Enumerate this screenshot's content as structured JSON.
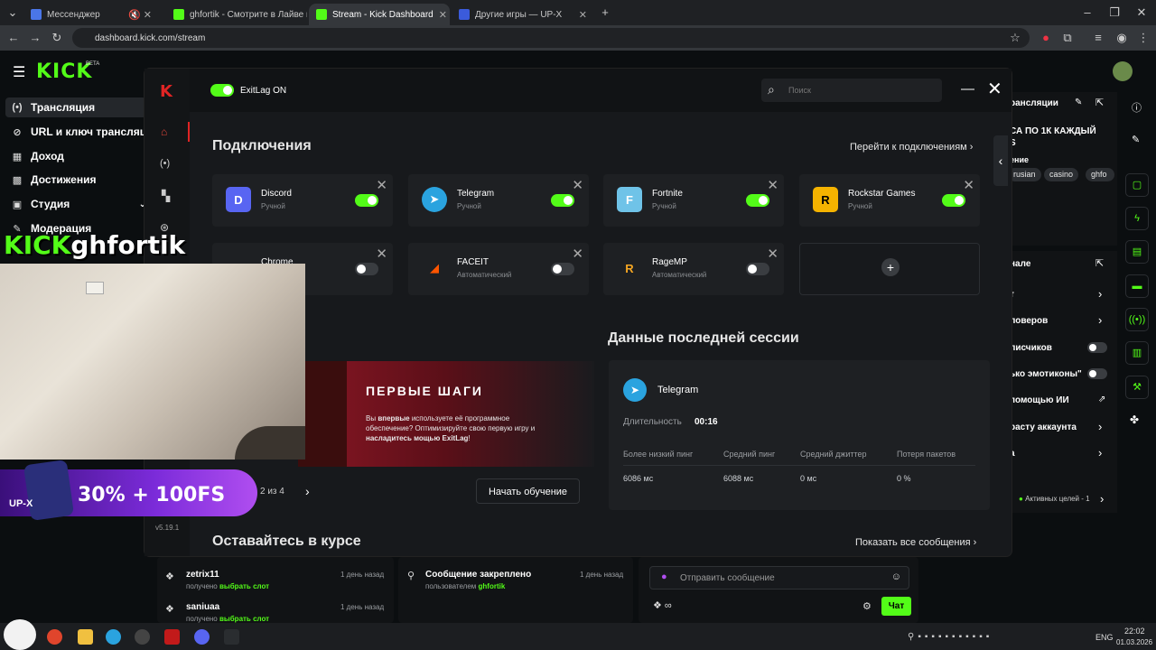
{
  "browser": {
    "tabs": [
      {
        "title": "Мессенджер",
        "color": "#4a76e8"
      },
      {
        "title": "ghfortik - Смотрите в Лайве н",
        "color": "#53fc18"
      },
      {
        "title": "Stream - Kick Dashboard",
        "color": "#53fc18"
      },
      {
        "title": "Другие игры — UP-X",
        "color": "#3b5bdb"
      }
    ],
    "url": "dashboard.kick.com/stream"
  },
  "kick": {
    "logo": "KICK",
    "beta": "BETA",
    "sidebar": [
      {
        "label": "Трансляция",
        "icon": "(•)"
      },
      {
        "label": "URL и ключ трансляции",
        "icon": "⊘"
      },
      {
        "label": "Доход",
        "icon": "▦"
      },
      {
        "label": "Достижения",
        "icon": "▩"
      },
      {
        "label": "Студия",
        "icon": "▣"
      },
      {
        "label": "Модерация",
        "icon": "✎"
      }
    ],
    "right_panel": {
      "title": "рансляции",
      "stream_title": "СА ПО 1К КАЖДЫЙ",
      "stream_title2": "S",
      "section": "ение",
      "tags": [
        "rusian",
        "casino",
        "ghfo"
      ],
      "chat_title": "нале",
      "rows": [
        "т",
        "ловеров",
        "лисчиков",
        "ько эмотиконы\"",
        "помощью ИИ",
        "расту аккаунта",
        "а"
      ],
      "goals": "Активных целей - 1"
    }
  },
  "exitlag": {
    "status": "ExitLag ON",
    "search_placeholder": "Поиск",
    "connections_title": "Подключения",
    "connections_link": "Перейти к подключениям",
    "apps": [
      {
        "name": "Discord",
        "mode": "Ручной",
        "on": true,
        "icon": "D",
        "color": "#5865f2"
      },
      {
        "name": "Telegram",
        "mode": "Ручной",
        "on": true,
        "icon": "➤",
        "color": "#2aa3df"
      },
      {
        "name": "Fortnite",
        "mode": "Ручной",
        "on": true,
        "icon": "F",
        "color": "#6fc3e8"
      },
      {
        "name": "Rockstar Games",
        "mode": "Ручной",
        "on": true,
        "icon": "R",
        "color": "#f5b300"
      },
      {
        "name": "Chrome",
        "mode": "",
        "on": false,
        "icon": "",
        "color": "#e0452c"
      },
      {
        "name": "FACEIT",
        "mode": "Автоматический",
        "on": false,
        "icon": "◢",
        "color": "#ff5500"
      },
      {
        "name": "RageMP",
        "mode": "Автоматический",
        "on": false,
        "icon": "R",
        "color": "#f5a623"
      }
    ],
    "last_session_title": "Данные последней сессии",
    "session": {
      "app": "Telegram",
      "duration_label": "Длительность",
      "duration": "00:16",
      "headers": [
        "Более низкий пинг",
        "Средний пинг",
        "Средний джиттер",
        "Потеря пакетов"
      ],
      "values": [
        "6086 мс",
        "6088 мс",
        "0 мс",
        "0 %"
      ]
    },
    "banner": {
      "title": "ПЕРВЫЕ ШАГИ",
      "text_a": "Вы ",
      "text_b": "впервые",
      "text_c": " используете её программное обеспечение? Оптимизируйте свою первую игру и ",
      "text_d": "насладитесь мощью ExitLag",
      "text_e": "!"
    },
    "pager": "2 из 4",
    "start_button": "Начать обучение",
    "version": "v5.19.1",
    "stay_title": "Оставайтесь в курсе",
    "show_all": "Показать все сообщения"
  },
  "overlay": {
    "streamer": "ghfortik",
    "kick": "KICK",
    "promo": "30% + 100FS",
    "upx": "UP-X"
  },
  "feed": [
    {
      "name": "zetrix11",
      "action": "получено ",
      "target": "выбрать слот",
      "time": "1 день назад"
    },
    {
      "name": "saniuaa",
      "action": "получено ",
      "target": "выбрать слот",
      "time": "1 день назад"
    }
  ],
  "pinned": {
    "title": "Сообщение закреплено",
    "by": "пользователем ",
    "user": "ghfortik",
    "time": "1 день назад"
  },
  "chat": {
    "placeholder": "Отправить сообщение",
    "send": "Чат"
  },
  "taskbar": {
    "lang": "ENG",
    "time": "22:02",
    "date": "01.03.2026"
  }
}
